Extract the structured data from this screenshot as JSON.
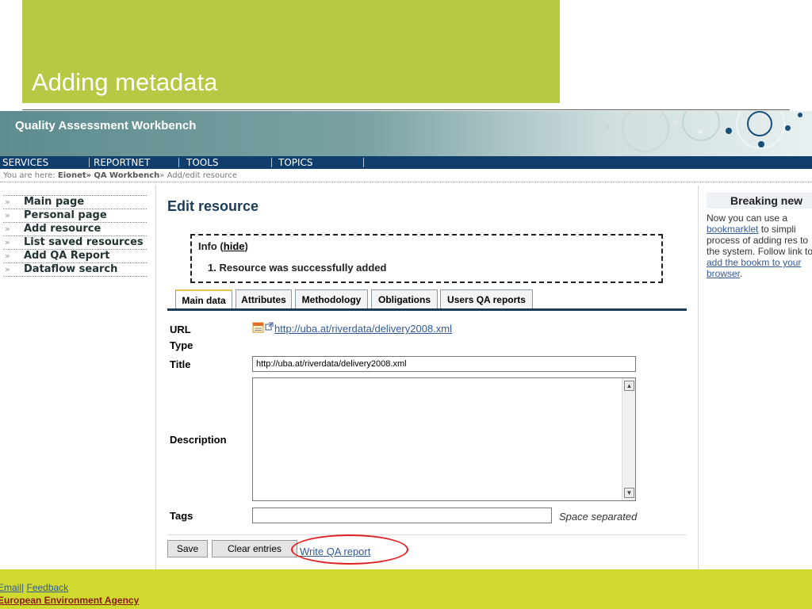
{
  "slide": {
    "title": "Adding metadata"
  },
  "app": {
    "title": "Quality Assessment Workbench"
  },
  "menu": [
    "SERVICES",
    "REPORTNET",
    "TOOLS",
    "TOPICS"
  ],
  "breadcrumb": {
    "prefix": "You are here:",
    "eionet": "Eionet",
    "sep": "»",
    "qaw": "QA Workbench",
    "current": "Add/edit resource"
  },
  "nav": [
    "Main page",
    "Personal page",
    "Add resource",
    "List saved resources",
    "Add QA Report",
    "Dataflow search"
  ],
  "main": {
    "heading": "Edit resource",
    "info": {
      "label": "Info (",
      "hide": "hide",
      "close": ")",
      "message": "1.  Resource was successfully added"
    },
    "tabs": [
      "Main data",
      "Attributes",
      "Methodology",
      "Obligations",
      "Users QA reports"
    ],
    "form": {
      "url_label": "URL",
      "type_label": "Type",
      "url_value": "http://uba.at/riverdata/delivery2008.xml",
      "title_label": "Title",
      "title_value": "http://uba.at/riverdata/delivery2008.xml",
      "description_label": "Description",
      "tags_label": "Tags",
      "tags_hint": "Space separated",
      "save": "Save",
      "clear": "Clear entries",
      "qa_link": "Write QA report"
    }
  },
  "sidebar": {
    "title": "Breaking new",
    "t1": "Now you can use a ",
    "bookmarklet": "bookmarklet",
    "t2": " to simpli process of adding res to the system. Follow link to ",
    "add_link": "add the bookm to your browser",
    "t3": "."
  },
  "footer": {
    "email": "Email",
    "sep": "|",
    "feedback": "Feedback",
    "agency": "European Environment Agency"
  }
}
